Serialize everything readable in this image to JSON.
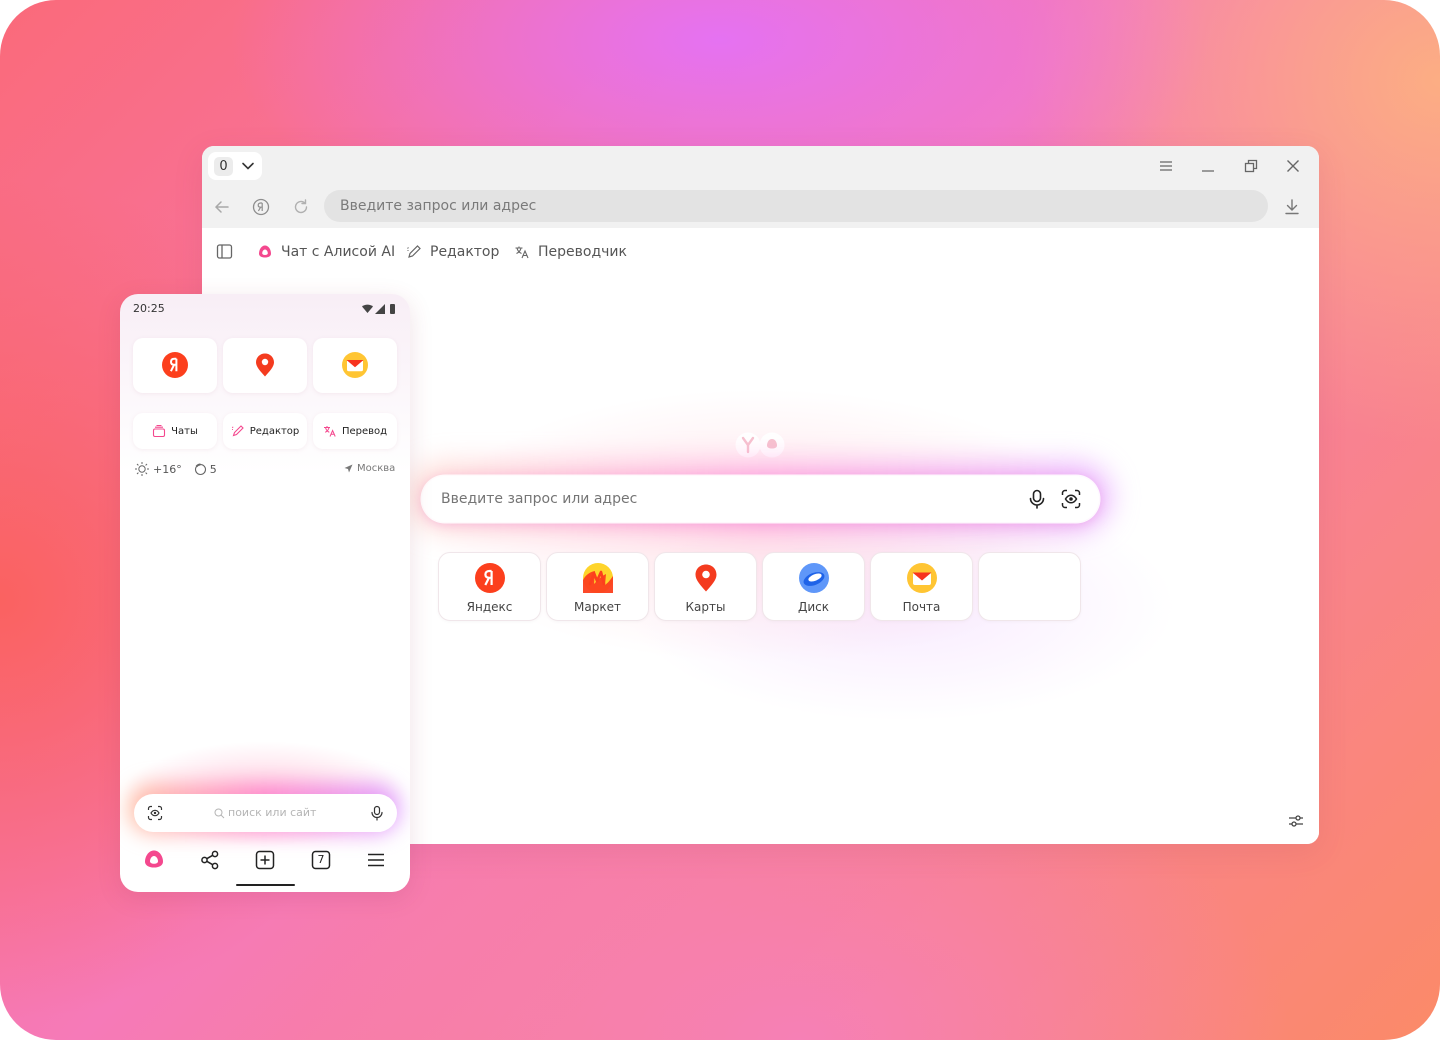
{
  "browser": {
    "tab_count": "0",
    "address_placeholder": "Введите запрос или адрес",
    "bookmarks": [
      {
        "label": "Чат с Алисой AI",
        "icon": "alice-icon"
      },
      {
        "label": "Редактор",
        "icon": "pen-icon"
      },
      {
        "label": "Переводчик",
        "icon": "translate-icon"
      }
    ],
    "search_placeholder": "Введите запрос или адрес",
    "tiles": [
      {
        "label": "Яндекс",
        "icon": "yandex-icon"
      },
      {
        "label": "Маркет",
        "icon": "market-icon"
      },
      {
        "label": "Карты",
        "icon": "maps-icon"
      },
      {
        "label": "Диск",
        "icon": "disk-icon"
      },
      {
        "label": "Почта",
        "icon": "mail-icon"
      }
    ]
  },
  "phone": {
    "time": "20:25",
    "chips": [
      {
        "label": "Чаты",
        "icon": "chats-icon"
      },
      {
        "label": "Редактор",
        "icon": "pen-icon"
      },
      {
        "label": "Перевод",
        "icon": "translate-icon"
      }
    ],
    "temperature": "+16°",
    "indicator_value": "5",
    "city": "Москва",
    "search_placeholder": "поиск или сайт",
    "tabs_count": "7"
  },
  "colors": {
    "yandex_red": "#fc3f1d",
    "accent_pink": "#f4488e",
    "disk_blue": "#2f7cf6",
    "mail_orange": "#f7b500"
  }
}
